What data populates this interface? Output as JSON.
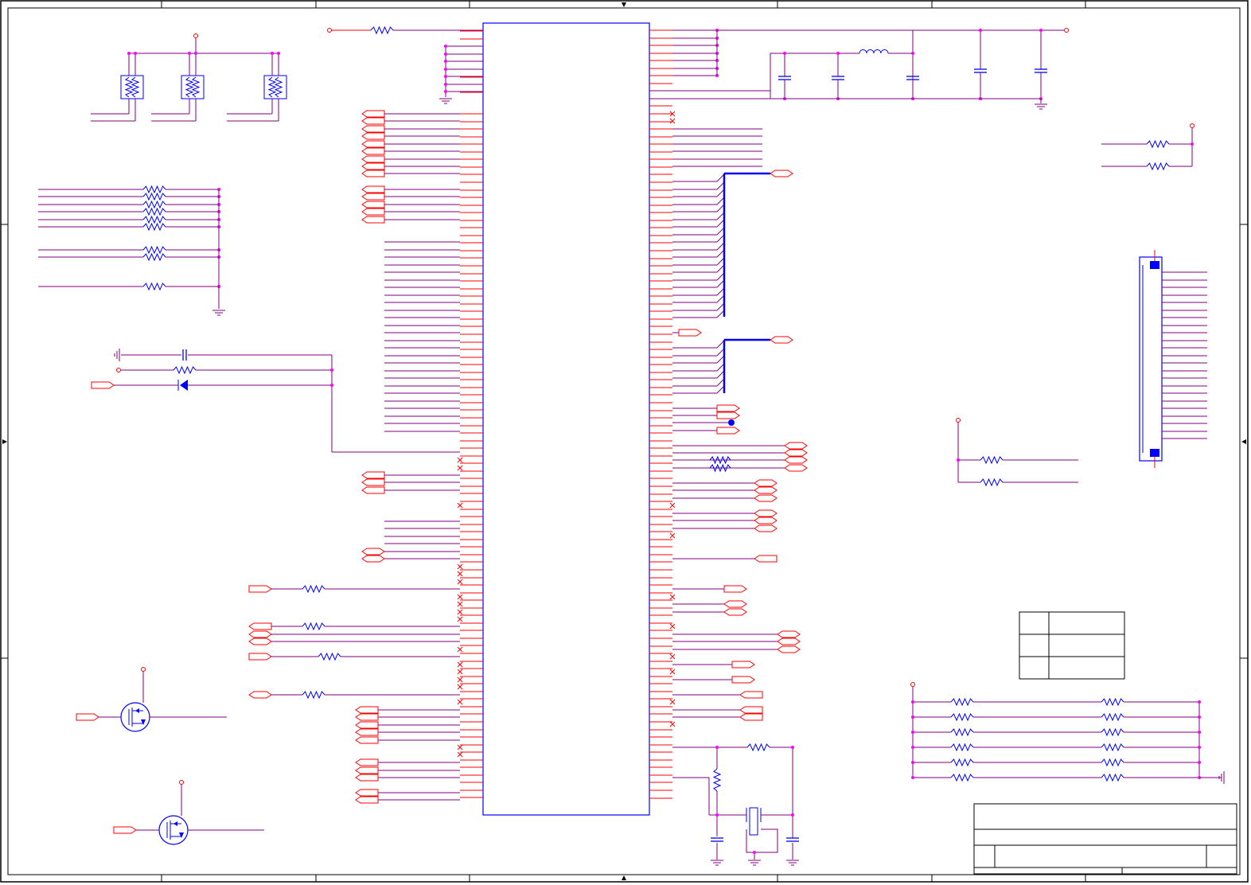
{
  "schematic": {
    "colors": {
      "paper": "#ffffff",
      "frame": "#000000",
      "wire_red": "#ff0000",
      "wire_purple": "#800080",
      "component_blue": "#0000ff",
      "junction_magenta": "#ff00ff",
      "title_block": "#000000"
    },
    "components": {
      "main_ic": "mcu-chip",
      "fets": "mosfet-symbol",
      "crystal": "crystal-oscillator-symbol",
      "connector": "fpc-connector"
    }
  }
}
